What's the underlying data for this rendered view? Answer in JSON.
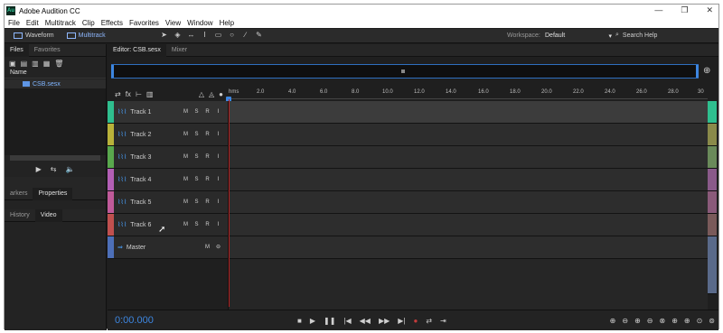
{
  "app": {
    "logo": "Au",
    "title": "Adobe Audition CC"
  },
  "window_controls": {
    "minimize": "—",
    "restore": "❐",
    "close": "✕"
  },
  "menu": [
    "File",
    "Edit",
    "Multitrack",
    "Clip",
    "Effects",
    "Favorites",
    "View",
    "Window",
    "Help"
  ],
  "toolbar": {
    "waveform_label": "Waveform",
    "multitrack_label": "Multitrack",
    "tools": [
      "move-tool-icon",
      "razor-tool-icon",
      "slip-tool-icon",
      "time-selection-icon",
      "marquee-icon",
      "lasso-icon",
      "brush-icon",
      "spot-healing-icon"
    ],
    "workspace_label": "Workspace:",
    "workspace_value": "Default",
    "search_label": "Search Help"
  },
  "left_panel": {
    "top_tabs": [
      "Files",
      "Favorites"
    ],
    "name_column": "Name",
    "files": [
      "CSB.sesx"
    ],
    "mid_tabs": [
      "arkers",
      "Properties"
    ],
    "bottom_tabs": [
      "History",
      "Video"
    ]
  },
  "editor": {
    "tabs": [
      "Editor: CSB.sesx",
      "Mixer"
    ],
    "ruler_labels": [
      "hms",
      "2.0",
      "4.0",
      "6.0",
      "8.0",
      "10.0",
      "12.0",
      "14.0",
      "16.0",
      "18.0",
      "20.0",
      "22.0",
      "24.0",
      "26.0",
      "28.0",
      "30"
    ],
    "tracks": [
      {
        "name": "Track 1",
        "color": "#2fbf8f",
        "buttons": [
          "M",
          "S",
          "R",
          "I"
        ]
      },
      {
        "name": "Track 2",
        "color": "#b9b23a",
        "buttons": [
          "M",
          "S",
          "R",
          "I"
        ]
      },
      {
        "name": "Track 3",
        "color": "#59a84d",
        "buttons": [
          "M",
          "S",
          "R",
          "I"
        ]
      },
      {
        "name": "Track 4",
        "color": "#b35fb6",
        "buttons": [
          "M",
          "S",
          "R",
          "I"
        ]
      },
      {
        "name": "Track 5",
        "color": "#c05a9a",
        "buttons": [
          "M",
          "S",
          "R",
          "I"
        ]
      },
      {
        "name": "Track 6",
        "color": "#c0504f",
        "buttons": [
          "M",
          "S",
          "R",
          "I"
        ]
      }
    ],
    "master": {
      "name": "Master",
      "color": "#4d6fb8",
      "buttons": [
        "M",
        "⊖"
      ]
    },
    "right_strip_colors": [
      "#2fbf8f",
      "#8a8a4a",
      "#6a8a5a",
      "#8a5a8a",
      "#8a5a7a",
      "#7a5a5a",
      "#5a6a8a"
    ]
  },
  "timecode": "0:00.000",
  "transport": [
    "■",
    "▶",
    "❚❚",
    "|◀",
    "◀◀",
    "▶▶",
    "▶|",
    "●",
    "⇄",
    "⇥"
  ],
  "zoom_buttons": [
    "zoom-in-amplitude-icon",
    "zoom-out-amplitude-icon",
    "zoom-in-time-icon",
    "zoom-out-time-icon",
    "zoom-full-icon",
    "zoom-in-left-icon",
    "zoom-in-right-icon",
    "zoom-selection-icon",
    "zoom-all-icon"
  ]
}
